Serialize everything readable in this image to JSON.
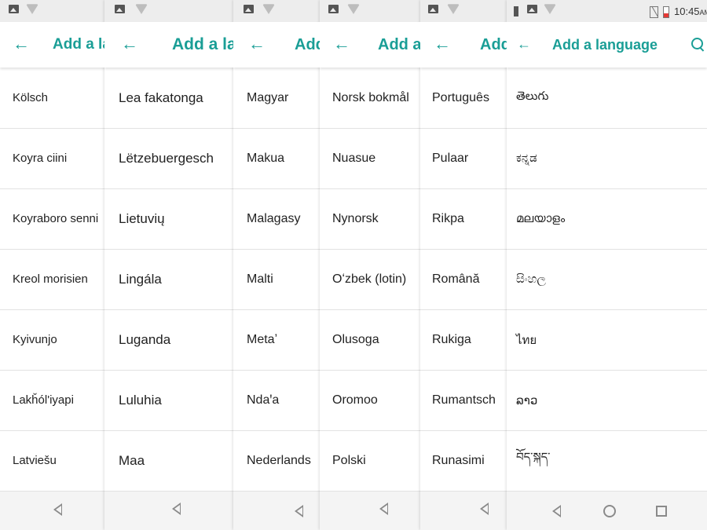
{
  "screens": [
    {
      "title": "Add a language",
      "items": [
        "Kölsch",
        "Koyra ciini",
        "Koyraboro senni",
        "Kreol morisien",
        "Kyivunjo",
        "Lakȟól'iyapi",
        "Latviešu"
      ]
    },
    {
      "title": "Add a language",
      "items": [
        "Lea fakatonga",
        "Lëtzebuergesch",
        "Lietuvių",
        "Lingála",
        "Luganda",
        "Luluhia",
        "Maa"
      ]
    },
    {
      "title": "Add a language",
      "items": [
        "Magyar",
        "Makua",
        "Malagasy",
        "Malti",
        "Metaʼ",
        "Ndaꞌa",
        "Nederlands"
      ]
    },
    {
      "title": "Add a language",
      "items": [
        "Norsk bokmål",
        "Nuasue",
        "Nynorsk",
        "Oʻzbek (lotin)",
        "Olusoga",
        "Oromoo",
        "Polski"
      ]
    },
    {
      "title": "Add a language",
      "items": [
        "Português",
        "Pulaar",
        "Rikpa",
        "Română",
        "Rukiga",
        "Rumantsch",
        "Runasimi"
      ]
    },
    {
      "title": "Add a language",
      "items": [
        "తెలుగు",
        "ಕನ್ನಡ",
        "മലയാളം",
        "සිංහල",
        "ไทย",
        "ລາວ",
        "བོད་སྐད་"
      ]
    }
  ],
  "status_bar": {
    "time": "10:45",
    "ampm": "AM"
  },
  "icons": {
    "back": "arrow-left-icon",
    "search": "search-icon",
    "nav_back": "triangle-back-icon",
    "nav_home": "circle-home-icon",
    "nav_recent": "square-recents-icon"
  },
  "colors": {
    "accent": "#1a9e96",
    "text": "#222222",
    "divider": "#e2e2e2"
  }
}
